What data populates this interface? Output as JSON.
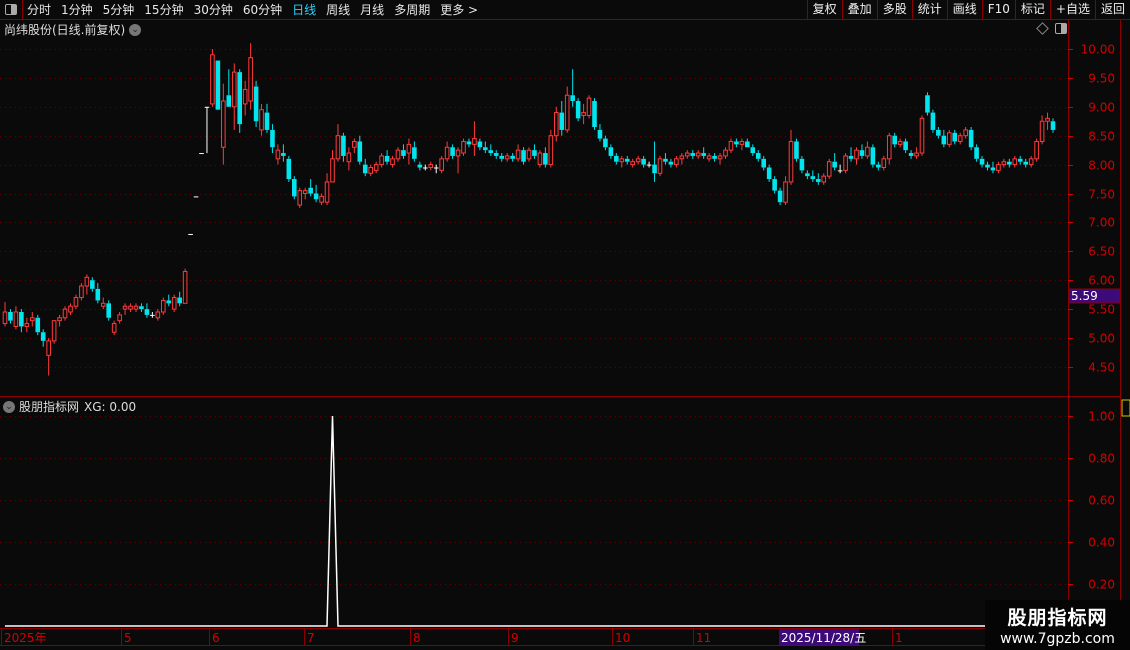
{
  "toolbar": {
    "periods": [
      "分时",
      "1分钟",
      "5分钟",
      "15分钟",
      "30分钟",
      "60分钟",
      "日线",
      "周线",
      "月线",
      "多周期",
      "更多 >"
    ],
    "active_period": "日线",
    "buttons": [
      "复权",
      "叠加",
      "多股",
      "统计",
      "画线",
      "F10",
      "标记",
      "+自选",
      "返回"
    ]
  },
  "chart": {
    "title": "尚纬股份(日线.前复权)",
    "current_price_label": "5.59",
    "y_ticks": [
      "10.00",
      "9.50",
      "9.00",
      "8.50",
      "8.00",
      "7.50",
      "7.00",
      "6.50",
      "6.00",
      "5.50",
      "5.00",
      "4.50"
    ],
    "colors": {
      "up": "#ff3b3b",
      "down": "#00e5ee",
      "flat": "#ffffff",
      "axis": "#d40000",
      "highlight": "#3d0a7a"
    }
  },
  "indicator": {
    "name": "股朋指标网",
    "value_label": "XG: 0.00",
    "y_ticks": [
      "1.00",
      "0.80",
      "0.60",
      "0.40",
      "0.20"
    ]
  },
  "date_axis": {
    "labels": [
      "2025年",
      "5",
      "6",
      "7",
      "8",
      "9",
      "10",
      "11",
      "1"
    ],
    "cursor_date": "2025/11/28/五"
  },
  "watermark": {
    "line1": "股朋指标网",
    "line2": "www.7gpzb.com"
  },
  "chart_data": {
    "type": "candlestick",
    "ylim": [
      4.3,
      10.2
    ],
    "candles": [
      [
        5.25,
        5.62,
        5.2,
        5.45
      ],
      [
        5.45,
        5.5,
        5.25,
        5.3
      ],
      [
        5.2,
        5.55,
        5.15,
        5.45
      ],
      [
        5.45,
        5.5,
        5.1,
        5.2
      ],
      [
        5.2,
        5.35,
        5.1,
        5.25
      ],
      [
        5.3,
        5.45,
        5.2,
        5.35
      ],
      [
        5.35,
        5.4,
        5.05,
        5.1
      ],
      [
        5.1,
        5.15,
        4.85,
        4.95
      ],
      [
        4.7,
        5.0,
        4.35,
        4.95
      ],
      [
        4.95,
        5.3,
        4.9,
        5.3
      ],
      [
        5.3,
        5.4,
        5.2,
        5.35
      ],
      [
        5.35,
        5.55,
        5.3,
        5.5
      ],
      [
        5.45,
        5.6,
        5.4,
        5.55
      ],
      [
        5.55,
        5.75,
        5.5,
        5.7
      ],
      [
        5.7,
        5.95,
        5.65,
        5.9
      ],
      [
        5.9,
        6.1,
        5.75,
        6.05
      ],
      [
        6.0,
        6.05,
        5.8,
        5.85
      ],
      [
        5.85,
        5.95,
        5.6,
        5.65
      ],
      [
        5.55,
        5.7,
        5.5,
        5.6
      ],
      [
        5.6,
        5.65,
        5.3,
        5.35
      ],
      [
        5.1,
        5.3,
        5.05,
        5.25
      ],
      [
        5.3,
        5.45,
        5.25,
        5.4
      ],
      [
        5.5,
        5.6,
        5.4,
        5.55
      ],
      [
        5.5,
        5.6,
        5.45,
        5.55
      ],
      [
        5.5,
        5.6,
        5.45,
        5.55
      ],
      [
        5.55,
        5.6,
        5.45,
        5.5
      ],
      [
        5.5,
        5.6,
        5.35,
        5.4
      ],
      [
        5.4,
        5.45,
        5.35,
        5.4
      ],
      [
        5.35,
        5.5,
        5.3,
        5.45
      ],
      [
        5.45,
        5.7,
        5.4,
        5.65
      ],
      [
        5.65,
        5.75,
        5.55,
        5.6
      ],
      [
        5.5,
        5.75,
        5.45,
        5.7
      ],
      [
        5.7,
        5.8,
        5.55,
        5.6
      ],
      [
        5.6,
        6.2,
        5.6,
        6.15
      ],
      [
        6.8,
        6.8,
        6.8,
        6.8
      ],
      [
        7.45,
        7.45,
        7.45,
        7.45
      ],
      [
        8.2,
        8.2,
        8.2,
        8.2
      ],
      [
        9.0,
        9.0,
        8.2,
        9.0
      ],
      [
        9.05,
        10.0,
        9.0,
        9.9
      ],
      [
        9.8,
        9.8,
        8.95,
        8.95
      ],
      [
        8.3,
        9.4,
        8.0,
        9.1
      ],
      [
        9.2,
        9.65,
        9.0,
        9.0
      ],
      [
        9.0,
        9.75,
        8.6,
        9.6
      ],
      [
        9.6,
        9.65,
        8.55,
        8.7
      ],
      [
        9.05,
        9.45,
        8.85,
        9.3
      ],
      [
        9.1,
        10.1,
        8.95,
        9.85
      ],
      [
        9.35,
        9.45,
        8.65,
        8.75
      ],
      [
        8.6,
        9.05,
        8.5,
        8.95
      ],
      [
        8.9,
        9.05,
        8.55,
        8.6
      ],
      [
        8.6,
        8.7,
        8.2,
        8.3
      ],
      [
        8.1,
        8.35,
        8.0,
        8.25
      ],
      [
        8.2,
        8.35,
        8.05,
        8.15
      ],
      [
        8.1,
        8.15,
        7.7,
        7.75
      ],
      [
        7.75,
        7.8,
        7.4,
        7.45
      ],
      [
        7.3,
        7.6,
        7.25,
        7.55
      ],
      [
        7.5,
        7.6,
        7.4,
        7.55
      ],
      [
        7.6,
        7.75,
        7.45,
        7.5
      ],
      [
        7.5,
        7.65,
        7.35,
        7.4
      ],
      [
        7.35,
        7.5,
        7.3,
        7.45
      ],
      [
        7.35,
        7.85,
        7.3,
        7.7
      ],
      [
        7.7,
        8.25,
        7.7,
        8.1
      ],
      [
        8.1,
        8.7,
        8.05,
        8.5
      ],
      [
        8.5,
        8.55,
        8.05,
        8.15
      ],
      [
        8.05,
        8.3,
        7.9,
        8.2
      ],
      [
        8.3,
        8.45,
        8.2,
        8.4
      ],
      [
        8.4,
        8.5,
        8.0,
        8.05
      ],
      [
        8.0,
        8.1,
        7.8,
        7.85
      ],
      [
        7.85,
        8.0,
        7.8,
        7.95
      ],
      [
        7.9,
        8.05,
        7.85,
        8.0
      ],
      [
        8.0,
        8.2,
        7.95,
        8.15
      ],
      [
        8.15,
        8.25,
        8.0,
        8.05
      ],
      [
        8.0,
        8.15,
        7.95,
        8.1
      ],
      [
        8.1,
        8.3,
        8.05,
        8.25
      ],
      [
        8.25,
        8.35,
        8.1,
        8.15
      ],
      [
        8.2,
        8.45,
        8.0,
        8.35
      ],
      [
        8.3,
        8.4,
        8.05,
        8.1
      ],
      [
        8.0,
        8.05,
        7.9,
        7.95
      ],
      [
        7.95,
        8.0,
        7.9,
        7.95
      ],
      [
        7.95,
        8.05,
        7.9,
        8.0
      ],
      [
        7.95,
        8.0,
        7.85,
        7.95
      ],
      [
        7.9,
        8.15,
        7.85,
        8.1
      ],
      [
        8.1,
        8.4,
        8.05,
        8.3
      ],
      [
        8.3,
        8.35,
        8.1,
        8.15
      ],
      [
        8.15,
        8.3,
        7.85,
        8.25
      ],
      [
        8.2,
        8.45,
        8.15,
        8.4
      ],
      [
        8.4,
        8.45,
        8.3,
        8.35
      ],
      [
        8.35,
        8.75,
        8.15,
        8.45
      ],
      [
        8.4,
        8.45,
        8.25,
        8.3
      ],
      [
        8.3,
        8.4,
        8.2,
        8.25
      ],
      [
        8.25,
        8.35,
        8.15,
        8.2
      ],
      [
        8.2,
        8.25,
        8.1,
        8.15
      ],
      [
        8.15,
        8.2,
        8.05,
        8.1
      ],
      [
        8.1,
        8.2,
        8.05,
        8.15
      ],
      [
        8.15,
        8.2,
        8.05,
        8.1
      ],
      [
        8.1,
        8.35,
        8.05,
        8.25
      ],
      [
        8.25,
        8.3,
        8.0,
        8.05
      ],
      [
        8.1,
        8.3,
        8.05,
        8.25
      ],
      [
        8.25,
        8.35,
        8.1,
        8.15
      ],
      [
        8.0,
        8.25,
        7.95,
        8.2
      ],
      [
        8.2,
        8.3,
        7.95,
        8.0
      ],
      [
        8.0,
        8.6,
        7.95,
        8.5
      ],
      [
        8.5,
        9.0,
        8.4,
        8.9
      ],
      [
        8.9,
        9.1,
        8.5,
        8.6
      ],
      [
        8.6,
        9.35,
        8.55,
        9.2
      ],
      [
        9.2,
        9.65,
        9.0,
        9.1
      ],
      [
        9.1,
        9.15,
        8.75,
        8.8
      ],
      [
        8.85,
        9.05,
        8.7,
        8.9
      ],
      [
        8.85,
        9.2,
        8.8,
        9.15
      ],
      [
        9.1,
        9.15,
        8.6,
        8.65
      ],
      [
        8.6,
        8.7,
        8.4,
        8.45
      ],
      [
        8.45,
        8.5,
        8.25,
        8.3
      ],
      [
        8.3,
        8.35,
        8.1,
        8.15
      ],
      [
        8.15,
        8.2,
        8.0,
        8.05
      ],
      [
        8.05,
        8.15,
        7.95,
        8.1
      ],
      [
        8.1,
        8.15,
        8.0,
        8.05
      ],
      [
        8.0,
        8.1,
        7.95,
        8.05
      ],
      [
        8.05,
        8.15,
        8.0,
        8.1
      ],
      [
        8.1,
        8.15,
        7.95,
        8.0
      ],
      [
        8.0,
        8.05,
        7.95,
        8.0
      ],
      [
        8.0,
        8.4,
        7.7,
        7.85
      ],
      [
        7.85,
        8.15,
        7.8,
        8.1
      ],
      [
        8.1,
        8.2,
        8.0,
        8.05
      ],
      [
        8.05,
        8.1,
        7.95,
        8.0
      ],
      [
        8.0,
        8.15,
        7.95,
        8.1
      ],
      [
        8.1,
        8.2,
        8.0,
        8.15
      ],
      [
        8.15,
        8.25,
        8.1,
        8.2
      ],
      [
        8.2,
        8.25,
        8.1,
        8.15
      ],
      [
        8.15,
        8.25,
        8.1,
        8.2
      ],
      [
        8.2,
        8.3,
        8.1,
        8.15
      ],
      [
        8.1,
        8.2,
        8.05,
        8.15
      ],
      [
        8.15,
        8.2,
        8.05,
        8.1
      ],
      [
        8.1,
        8.2,
        8.0,
        8.15
      ],
      [
        8.15,
        8.3,
        8.1,
        8.25
      ],
      [
        8.25,
        8.45,
        8.2,
        8.4
      ],
      [
        8.4,
        8.45,
        8.3,
        8.35
      ],
      [
        8.35,
        8.45,
        8.25,
        8.4
      ],
      [
        8.4,
        8.45,
        8.3,
        8.3
      ],
      [
        8.3,
        8.35,
        8.15,
        8.2
      ],
      [
        8.2,
        8.25,
        8.05,
        8.1
      ],
      [
        8.1,
        8.15,
        7.9,
        7.95
      ],
      [
        7.95,
        8.0,
        7.7,
        7.75
      ],
      [
        7.75,
        7.8,
        7.5,
        7.55
      ],
      [
        7.55,
        7.6,
        7.3,
        7.35
      ],
      [
        7.35,
        7.8,
        7.3,
        7.7
      ],
      [
        7.7,
        8.6,
        7.65,
        8.4
      ],
      [
        8.4,
        8.45,
        8.05,
        8.1
      ],
      [
        8.1,
        8.15,
        7.85,
        7.9
      ],
      [
        7.85,
        7.9,
        7.75,
        7.8
      ],
      [
        7.8,
        7.9,
        7.7,
        7.75
      ],
      [
        7.75,
        7.85,
        7.65,
        7.7
      ],
      [
        7.7,
        7.85,
        7.65,
        7.8
      ],
      [
        7.8,
        8.1,
        7.75,
        8.05
      ],
      [
        8.05,
        8.2,
        7.9,
        7.95
      ],
      [
        7.9,
        8.0,
        7.85,
        7.9
      ],
      [
        7.9,
        8.2,
        7.85,
        8.15
      ],
      [
        8.15,
        8.3,
        8.05,
        8.1
      ],
      [
        8.1,
        8.3,
        8.0,
        8.25
      ],
      [
        8.25,
        8.35,
        8.1,
        8.15
      ],
      [
        8.15,
        8.4,
        8.1,
        8.3
      ],
      [
        8.3,
        8.35,
        7.95,
        8.0
      ],
      [
        8.0,
        8.05,
        7.9,
        7.95
      ],
      [
        7.95,
        8.15,
        7.9,
        8.1
      ],
      [
        8.1,
        8.55,
        8.0,
        8.5
      ],
      [
        8.5,
        8.55,
        8.3,
        8.35
      ],
      [
        8.35,
        8.45,
        8.3,
        8.4
      ],
      [
        8.4,
        8.45,
        8.2,
        8.25
      ],
      [
        8.2,
        8.25,
        8.1,
        8.15
      ],
      [
        8.15,
        8.3,
        8.1,
        8.2
      ],
      [
        8.2,
        8.85,
        8.15,
        8.8
      ],
      [
        9.2,
        9.25,
        8.85,
        8.9
      ],
      [
        8.9,
        8.95,
        8.55,
        8.6
      ],
      [
        8.6,
        8.65,
        8.45,
        8.5
      ],
      [
        8.5,
        8.6,
        8.3,
        8.35
      ],
      [
        8.35,
        8.6,
        8.3,
        8.55
      ],
      [
        8.55,
        8.6,
        8.35,
        8.4
      ],
      [
        8.4,
        8.55,
        8.35,
        8.5
      ],
      [
        8.5,
        8.65,
        8.45,
        8.6
      ],
      [
        8.6,
        8.65,
        8.25,
        8.3
      ],
      [
        8.3,
        8.35,
        8.05,
        8.1
      ],
      [
        8.1,
        8.15,
        7.95,
        8.0
      ],
      [
        8.0,
        8.05,
        7.9,
        7.95
      ],
      [
        7.95,
        8.05,
        7.85,
        7.9
      ],
      [
        7.9,
        8.05,
        7.85,
        8.0
      ],
      [
        8.0,
        8.1,
        7.95,
        8.05
      ],
      [
        8.05,
        8.1,
        7.95,
        8.0
      ],
      [
        8.0,
        8.15,
        7.95,
        8.1
      ],
      [
        8.1,
        8.15,
        8.0,
        8.05
      ],
      [
        8.05,
        8.1,
        7.95,
        8.0
      ],
      [
        8.0,
        8.15,
        7.95,
        8.1
      ],
      [
        8.1,
        8.45,
        8.05,
        8.4
      ],
      [
        8.4,
        8.85,
        8.35,
        8.75
      ],
      [
        8.75,
        8.9,
        8.6,
        8.8
      ],
      [
        8.75,
        8.8,
        8.55,
        8.6
      ]
    ],
    "xg_signals": [
      {
        "index": 60,
        "value": 1
      }
    ],
    "xg_ylim": [
      0,
      1.0
    ]
  }
}
